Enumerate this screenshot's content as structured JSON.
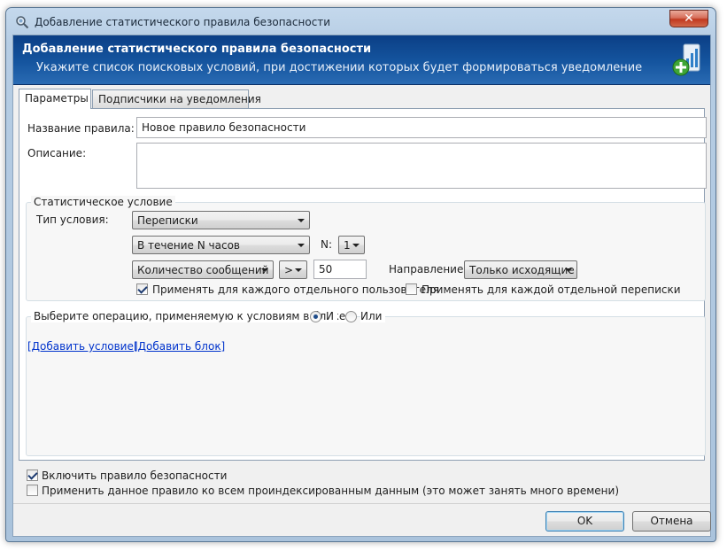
{
  "window": {
    "title": "Добавление статистического правила безопасности",
    "close_glyph": "✕"
  },
  "banner": {
    "title": "Добавление статистического правила безопасности",
    "subtitle": "Укажите список поисковых условий, при достижении которых будет формироваться уведомление",
    "icon": "add-chart-icon"
  },
  "tabs": [
    {
      "label": "Параметры",
      "active": true
    },
    {
      "label": "Подписчики на уведомления",
      "active": false
    }
  ],
  "form": {
    "rule_name_label": "Название правила:",
    "rule_name_value": "Новое правило безопасности",
    "description_label": "Описание:",
    "description_value": ""
  },
  "statistic": {
    "legend": "Статистическое условие",
    "condition_type_label": "Тип условия:",
    "condition_type_value": "Переписки",
    "period_value": "В течение N часов",
    "n_label": "N:",
    "n_value": "1",
    "metric_value": "Количество сообщений",
    "operator_value": ">",
    "threshold_value": "50",
    "direction_label": "Направление:",
    "direction_value": "Только исходящие",
    "per_user_label": "Применять для каждого отдельного пользователя",
    "per_user_checked": true,
    "per_conversation_label": "Применять для каждой отдельной переписки",
    "per_conversation_checked": false
  },
  "operations": {
    "legend": "Выберите операцию, применяемую к условиям в блоке:",
    "and_label": "И",
    "and_checked": true,
    "or_label": "Или",
    "or_checked": false,
    "add_condition_link": "[Добавить условие]",
    "add_block_link": "[Добавить блок]"
  },
  "footer": {
    "enable_rule_label": "Включить правило безопасности",
    "enable_rule_checked": true,
    "apply_indexed_label": "Применить данное правило ко всем проиндексированным данным (это может занять много времени)",
    "apply_indexed_checked": false,
    "ok_label": "OK",
    "cancel_label": "Отмена"
  },
  "colors": {
    "banner": "#15559f",
    "link": "#0033cc",
    "close_button": "#c0391f"
  }
}
